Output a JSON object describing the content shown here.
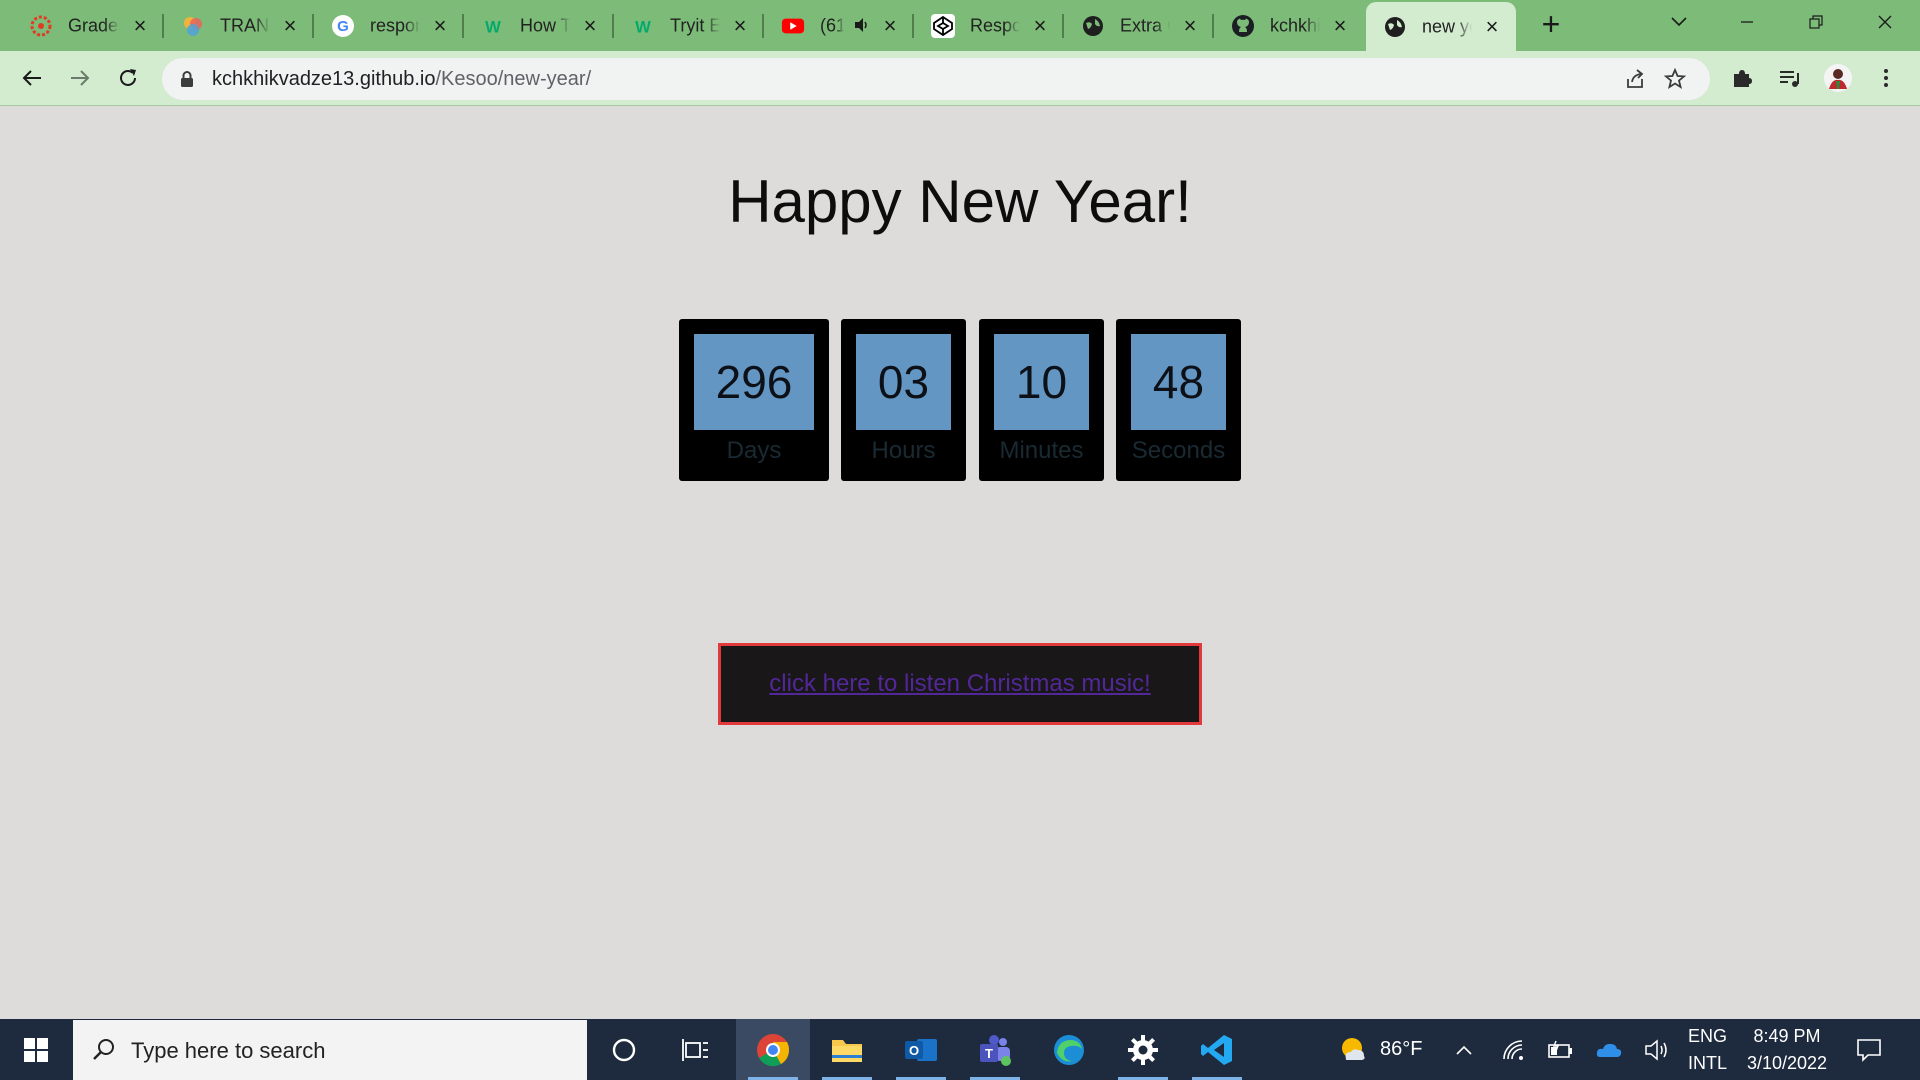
{
  "browser": {
    "tabs": [
      {
        "title": "Grades",
        "icon": "canvas-icon"
      },
      {
        "title": "TRANS",
        "icon": "colorful-logo-icon"
      },
      {
        "title": "respon",
        "icon": "google-icon"
      },
      {
        "title": "How To",
        "icon": "w-logo-icon"
      },
      {
        "title": "Tryit Ed",
        "icon": "w-logo-icon"
      },
      {
        "title": "(61",
        "icon": "youtube-icon"
      },
      {
        "title": "Respon",
        "icon": "codepen-icon"
      },
      {
        "title": "Extra C",
        "icon": "globe-icon"
      },
      {
        "title": "kchkhik",
        "icon": "github-icon"
      },
      {
        "title": "new ye",
        "icon": "globe-icon"
      }
    ],
    "active_tab_index": 9,
    "url_host": "kchkhikvadze13.github.io",
    "url_path": "/Kesoo/new-year/"
  },
  "page": {
    "heading": "Happy New Year!",
    "countdown": [
      {
        "value": "296",
        "label": "Days"
      },
      {
        "value": "03",
        "label": "Hours"
      },
      {
        "value": "10",
        "label": "Minutes"
      },
      {
        "value": "48",
        "label": "Seconds"
      }
    ],
    "music_link": "click here to listen Christmas music!"
  },
  "taskbar": {
    "search_placeholder": "Type here to search",
    "weather": "86°F",
    "lang_top": "ENG",
    "lang_bottom": "INTL",
    "time": "8:49 PM",
    "date": "3/10/2022"
  },
  "colors": {
    "tabstrip": "#7dbb78",
    "toolbar": "#d3ecd0",
    "page_bg": "#dddcdb",
    "timer_number_bg": "#6396c3",
    "music_border": "#e23a3a",
    "link": "#52279a"
  }
}
